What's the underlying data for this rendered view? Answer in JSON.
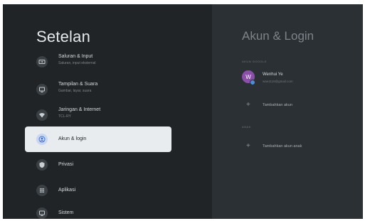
{
  "left": {
    "title": "Setelan",
    "items": [
      {
        "label": "Saluran & Input",
        "sub": "Saluran, input eksternal",
        "icon": "input-icon"
      },
      {
        "label": "Tampilan & Suara",
        "sub": "Gambar, layar, suara",
        "icon": "display-icon"
      },
      {
        "label": "Jaringan & Internet",
        "sub": "TCL-RY",
        "icon": "wifi-icon"
      },
      {
        "label": "Akun & login",
        "sub": "",
        "icon": "account-icon"
      },
      {
        "label": "Privasi",
        "sub": "",
        "icon": "shield-icon"
      },
      {
        "label": "Aplikasi",
        "sub": "",
        "icon": "apps-grid-icon"
      },
      {
        "label": "Sistem",
        "sub": "",
        "icon": "monitor-icon"
      }
    ],
    "selected_index": 3
  },
  "right": {
    "title": "Akun & Login",
    "accounts_section_label": "AKUN GOOGLE",
    "account": {
      "initial": "W",
      "name": "Wenhui Ye",
      "email": "wae1119@gmail.com"
    },
    "add_account": "Tambahkan akun",
    "kids_section_label": "ANAK",
    "add_kid_account": "Tambahkan akun anak"
  }
}
